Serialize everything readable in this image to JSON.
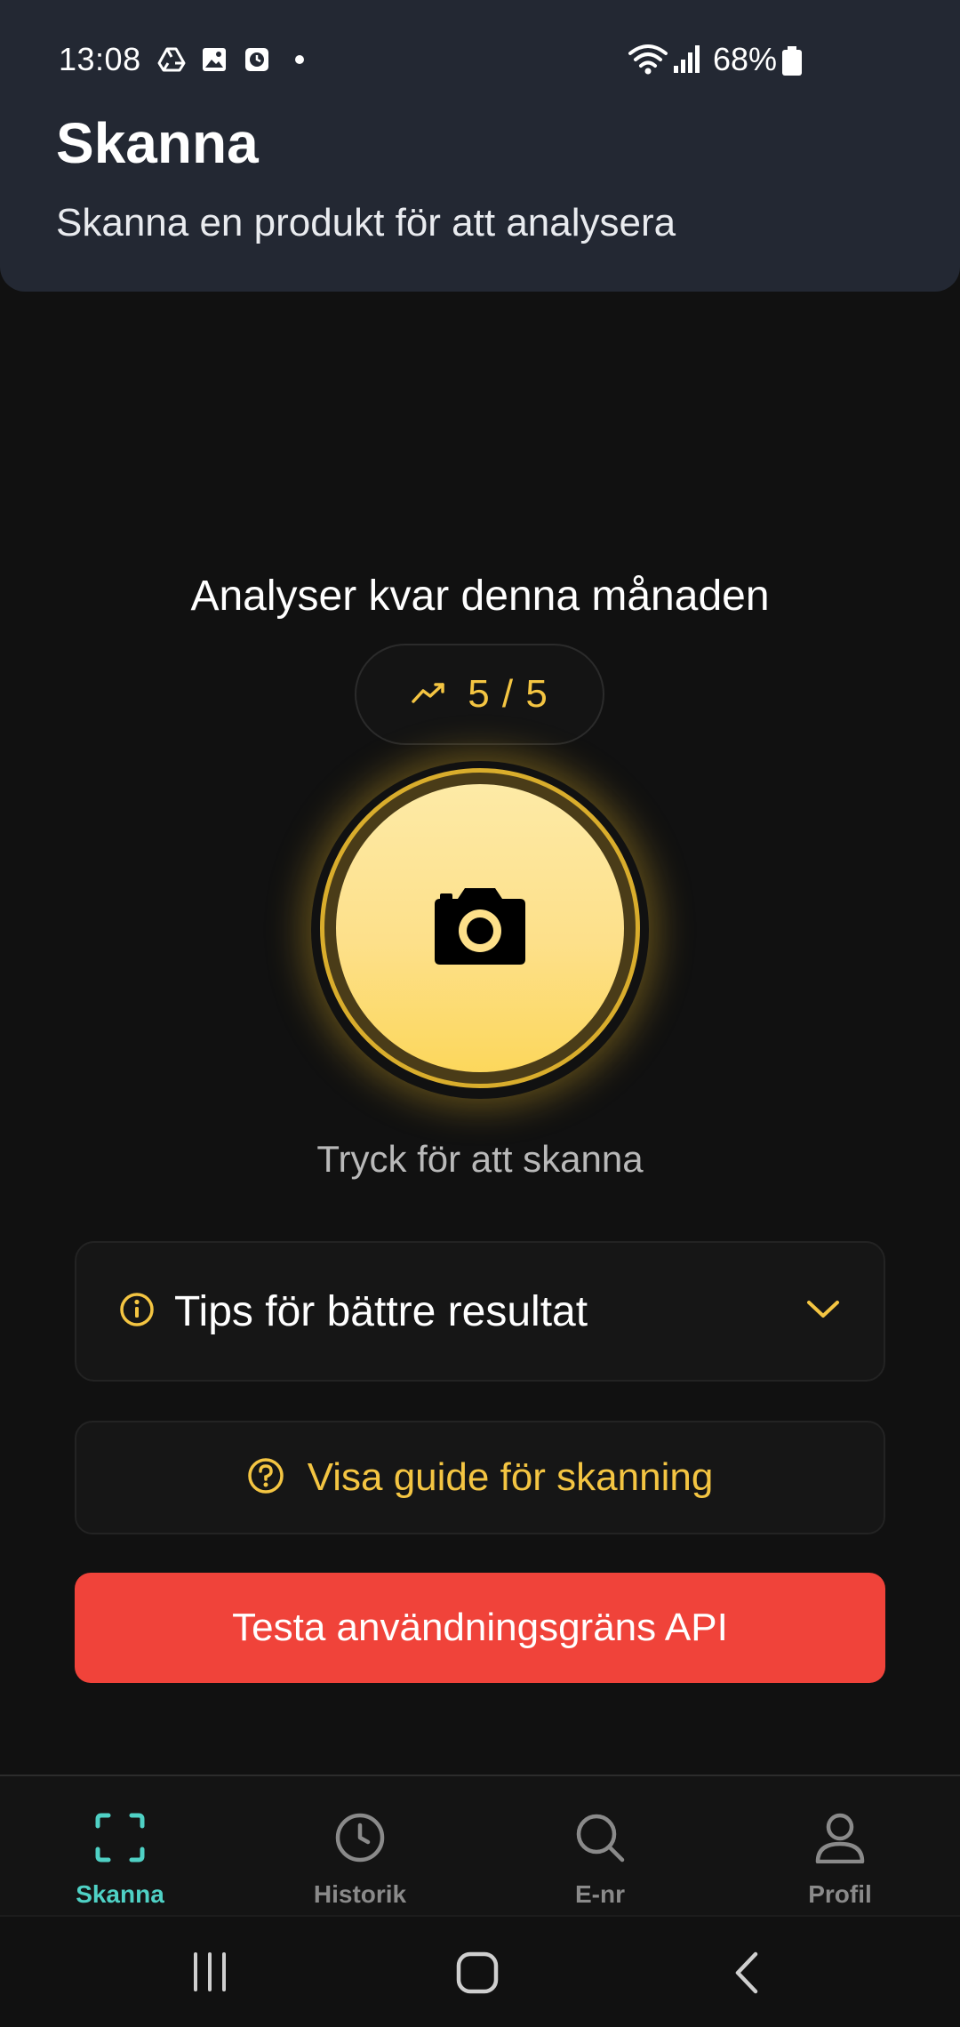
{
  "status_bar": {
    "time": "13:08",
    "battery": "68%"
  },
  "header": {
    "title": "Skanna",
    "subtitle": "Skanna en produkt för att analysera"
  },
  "usage": {
    "label": "Analyser kvar denna månaden",
    "counter": "5 / 5",
    "icon": "trending-up-icon"
  },
  "scan": {
    "icon": "camera-icon",
    "hint": "Tryck för att skanna"
  },
  "tips": {
    "label": "Tips för bättre resultat",
    "icon": "info-icon",
    "expand_icon": "chevron-down-icon"
  },
  "guide": {
    "label": "Visa guide för skanning",
    "icon": "help-circle-icon"
  },
  "api_button": {
    "label": "Testa användningsgräns API"
  },
  "bottom_nav": {
    "items": [
      {
        "label": "Skanna",
        "icon": "scan-icon",
        "active": true
      },
      {
        "label": "Historik",
        "icon": "clock-icon",
        "active": false
      },
      {
        "label": "E-nr",
        "icon": "search-icon",
        "active": false
      },
      {
        "label": "Profil",
        "icon": "user-icon",
        "active": false
      }
    ]
  },
  "colors": {
    "accent_yellow": "#f4c542",
    "accent_teal": "#4fd1c5",
    "danger_red": "#f0433a",
    "header_bg": "#232833",
    "background": "#111111"
  }
}
